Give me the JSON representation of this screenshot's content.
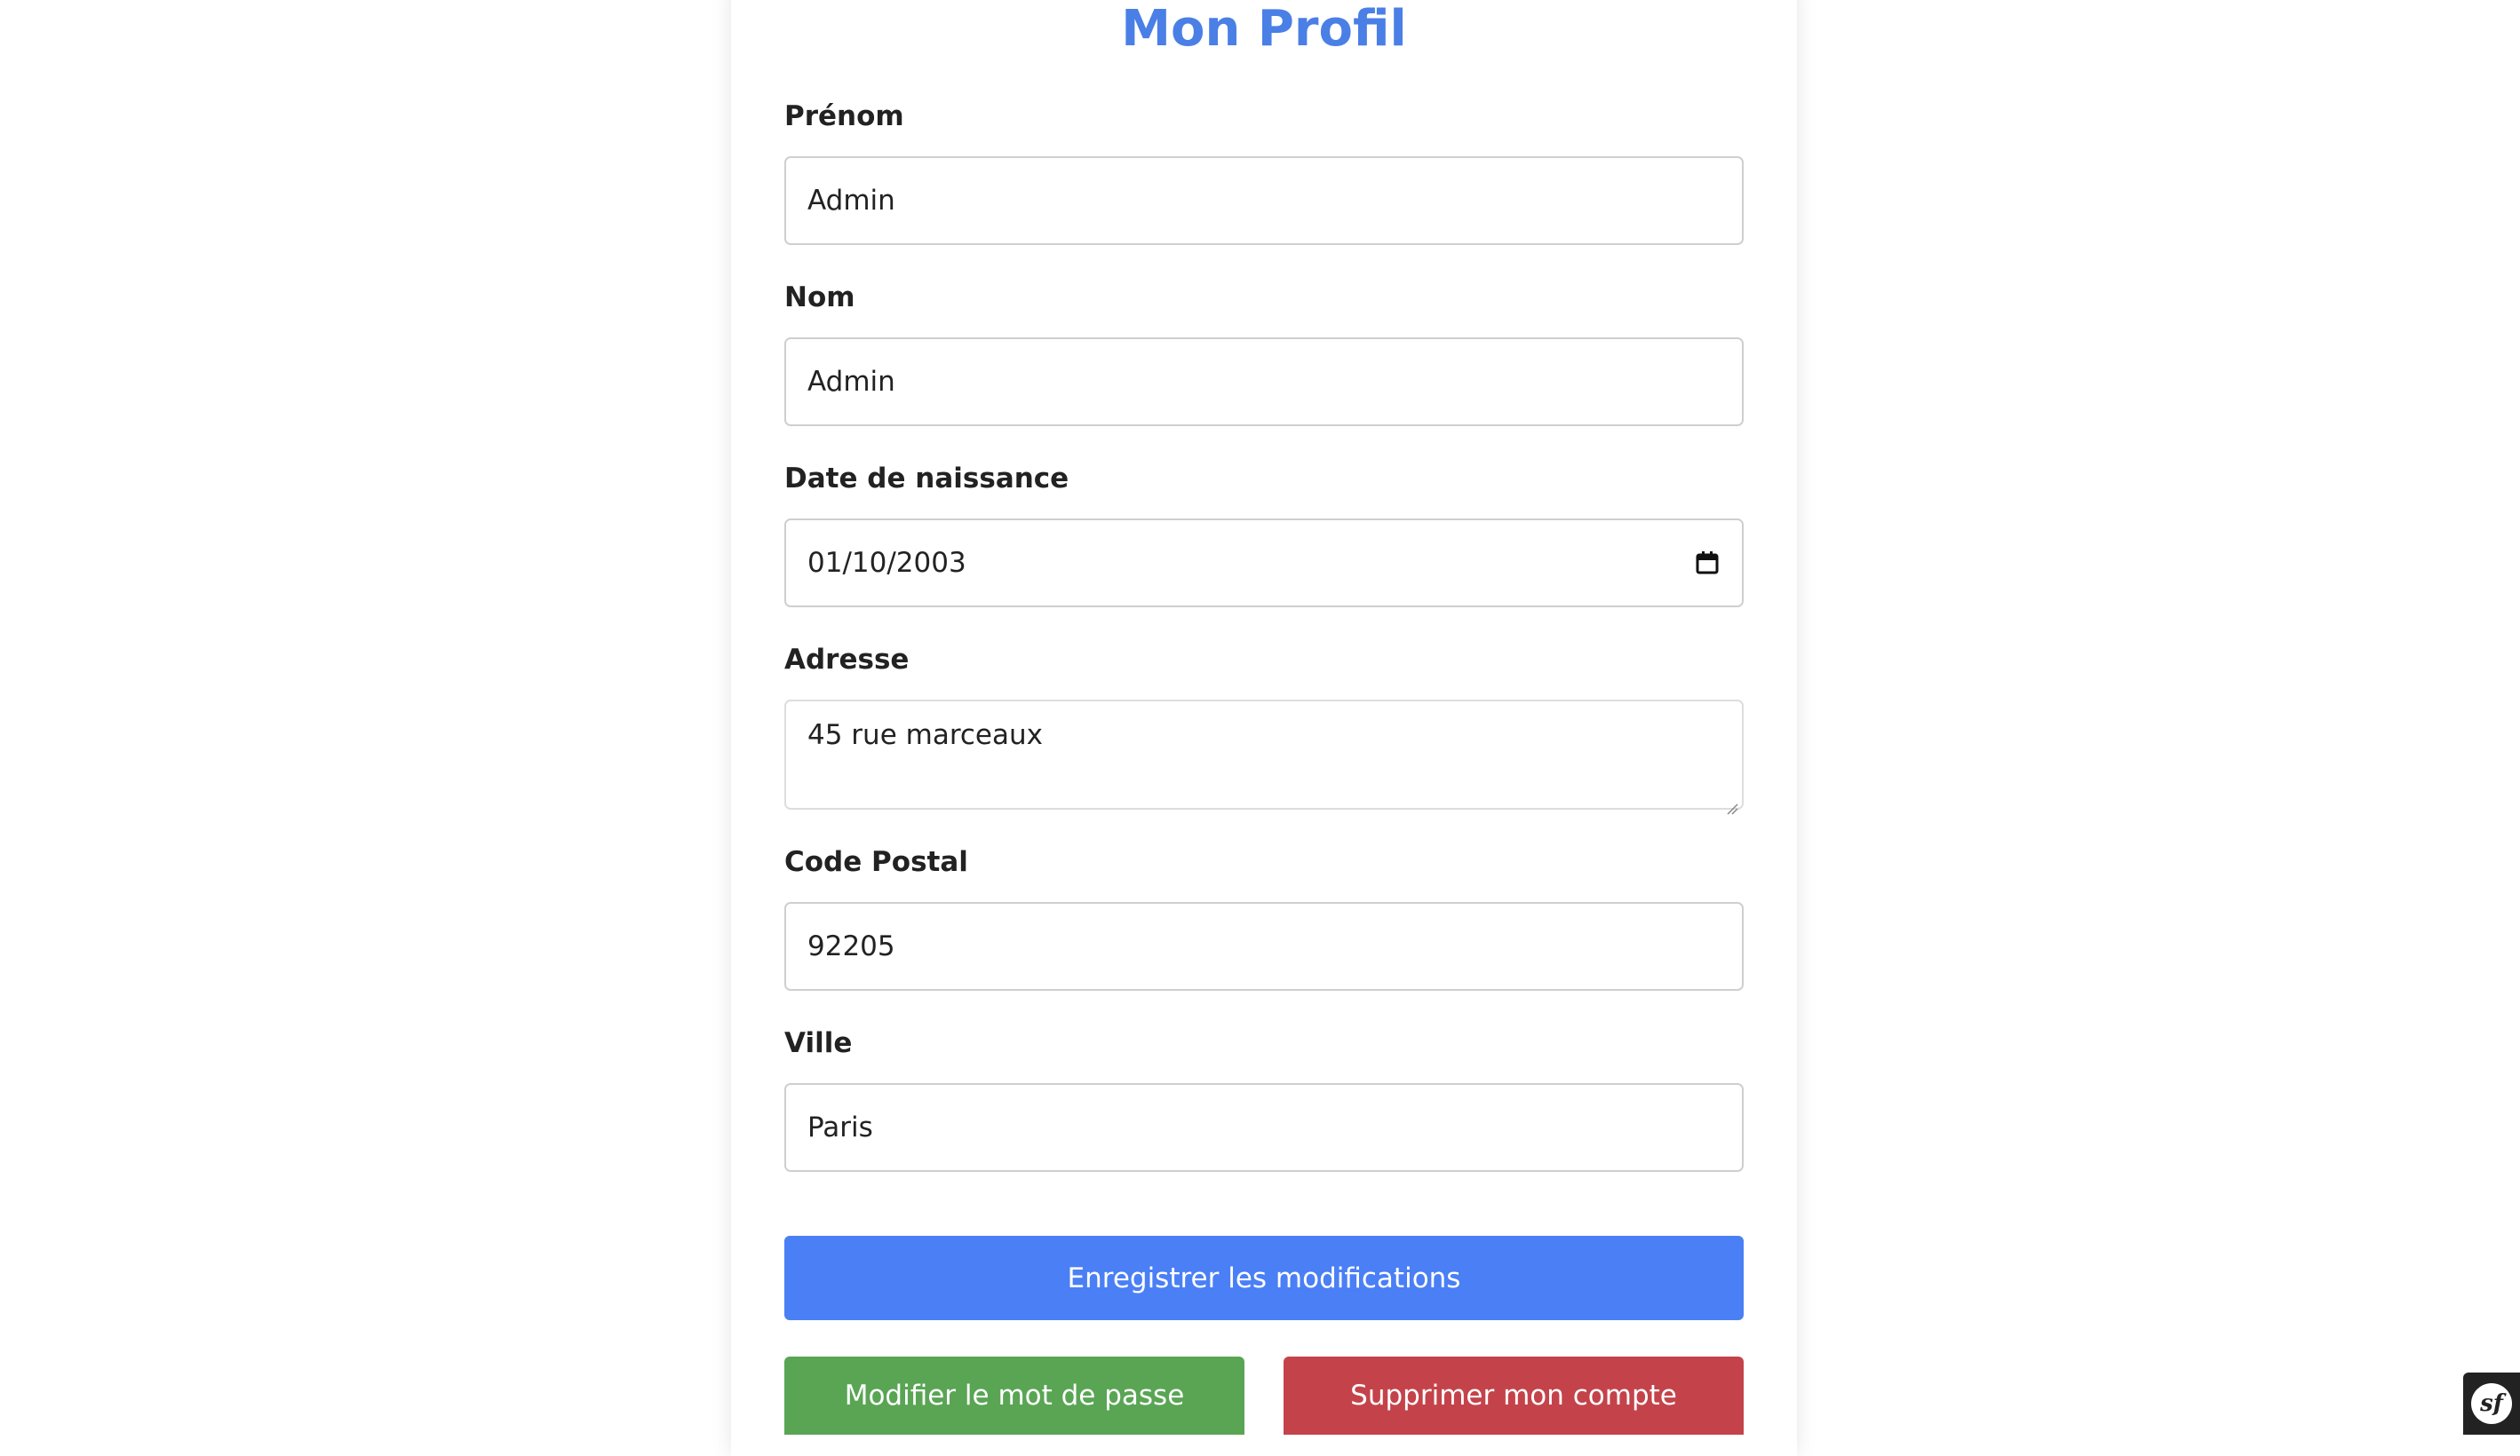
{
  "profile": {
    "title": "Mon Profil",
    "fields": {
      "prenom": {
        "label": "Prénom",
        "value": "Admin"
      },
      "nom": {
        "label": "Nom",
        "value": "Admin"
      },
      "birthdate": {
        "label": "Date de naissance",
        "value": "01/10/2003"
      },
      "adresse": {
        "label": "Adresse",
        "value": "45 rue marceaux"
      },
      "code_postal": {
        "label": "Code Postal",
        "value": "92205"
      },
      "ville": {
        "label": "Ville",
        "value": "Paris"
      }
    },
    "buttons": {
      "save": "Enregistrer les modifications",
      "change_password": "Modifier le mot de passe",
      "delete_account": "Supprimer mon compte"
    }
  },
  "debug_toolbar": {
    "icon": "symfony-icon",
    "label": "sf"
  },
  "colors": {
    "title": "#4a7fe6",
    "save_button": "#4a7ff5",
    "password_button": "#59a554",
    "delete_button": "#c4434a"
  }
}
